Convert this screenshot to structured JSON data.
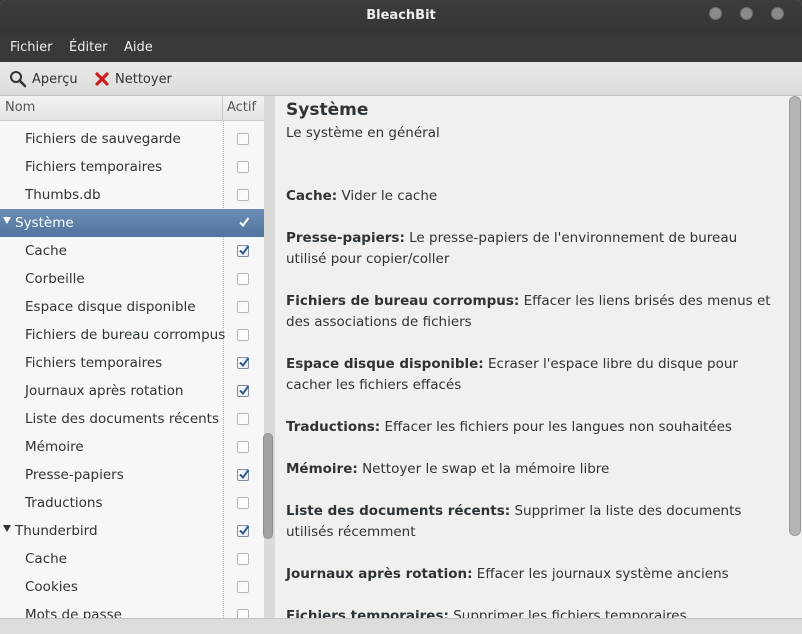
{
  "window": {
    "title": "BleachBit"
  },
  "menu": {
    "file": "Fichier",
    "edit": "Éditer",
    "help": "Aide"
  },
  "toolbar": {
    "preview": "Aperçu",
    "clean": "Nettoyer"
  },
  "tree": {
    "col_name": "Nom",
    "col_active": "Actif",
    "rows": [
      {
        "label": "Fichiers de sauvegarde",
        "checked": false
      },
      {
        "label": "Fichiers temporaires",
        "checked": false
      },
      {
        "label": "Thumbs.db",
        "checked": false
      },
      {
        "label": "Système",
        "checked": true,
        "parent": true,
        "selected": true
      },
      {
        "label": "Cache",
        "checked": true
      },
      {
        "label": "Corbeille",
        "checked": false
      },
      {
        "label": "Espace disque disponible",
        "checked": false
      },
      {
        "label": "Fichiers de bureau corrompus",
        "checked": false
      },
      {
        "label": "Fichiers temporaires",
        "checked": true
      },
      {
        "label": "Journaux après rotation",
        "checked": true
      },
      {
        "label": "Liste des documents récents",
        "checked": false
      },
      {
        "label": "Mémoire",
        "checked": false
      },
      {
        "label": "Presse-papiers",
        "checked": true
      },
      {
        "label": "Traductions",
        "checked": false
      },
      {
        "label": "Thunderbird",
        "checked": true,
        "parent": true
      },
      {
        "label": "Cache",
        "checked": false
      },
      {
        "label": "Cookies",
        "checked": false
      },
      {
        "label": "Mots de passe",
        "checked": false
      }
    ]
  },
  "detail": {
    "title": "Système",
    "subtitle": "Le système en général",
    "options": [
      {
        "name": "Cache:",
        "desc": " Vider le cache"
      },
      {
        "name": "Presse-papiers:",
        "desc": " Le presse-papiers de l'environnement de bureau utilisé pour copier/coller"
      },
      {
        "name": "Fichiers de bureau corrompus:",
        "desc": " Effacer les liens brisés des menus et des associations de fichiers"
      },
      {
        "name": "Espace disque disponible:",
        "desc": " Ecraser l'espace libre du disque pour cacher les fichiers effacés"
      },
      {
        "name": "Traductions:",
        "desc": " Effacer les fichiers pour les langues non souhaitées"
      },
      {
        "name": "Mémoire:",
        "desc": " Nettoyer le swap et la mémoire libre"
      },
      {
        "name": "Liste des documents récents:",
        "desc": " Supprimer la liste des documents utilisés récemment"
      },
      {
        "name": "Journaux après rotation:",
        "desc": " Effacer les journaux système anciens"
      },
      {
        "name": "Fichiers temporaires:",
        "desc": " Supprimer les fichiers temporaires"
      }
    ]
  }
}
